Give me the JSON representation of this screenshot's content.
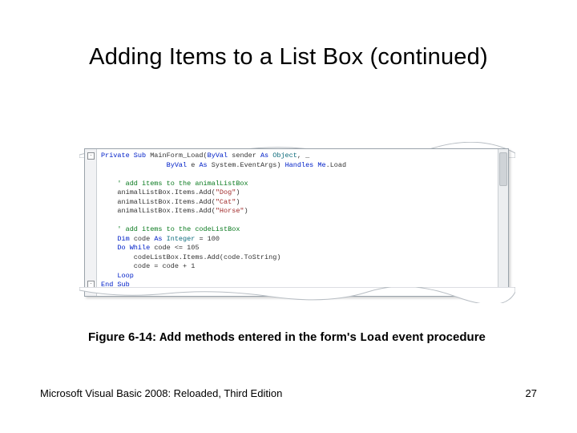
{
  "title": "Adding Items to a List Box (continued)",
  "code": {
    "l1a": "Private Sub",
    "l1b": " MainForm_Load(",
    "l1c": "ByVal",
    "l1d": " sender ",
    "l1e": "As",
    "l1f": " Object",
    "l1g": ", _",
    "l2a": "                ",
    "l2b": "ByVal",
    "l2c": " e ",
    "l2d": "As",
    "l2e": " System.EventArgs) ",
    "l2f": "Handles",
    "l2g": " ",
    "l2h": "Me",
    "l2i": ".Load",
    "blank1": "",
    "c1": "    ' add items to the animalListBox",
    "a1": "    animalListBox.Items.Add(",
    "a1s": "\"Dog\"",
    "a1e": ")",
    "a2": "    animalListBox.Items.Add(",
    "a2s": "\"Cat\"",
    "a2e": ")",
    "a3": "    animalListBox.Items.Add(",
    "a3s": "\"Horse\"",
    "a3e": ")",
    "blank2": "",
    "c2": "    ' add items to the codeListBox",
    "d1a": "    ",
    "d1b": "Dim",
    "d1c": " code ",
    "d1d": "As",
    "d1e": " Integer",
    "d1f": " = 100",
    "w1a": "    ",
    "w1b": "Do While",
    "w1c": " code <= 105",
    "b1": "        codeListBox.Items.Add(code.ToString)",
    "b2": "        code = code + 1",
    "lp": "    ",
    "lpk": "Loop",
    "es": "End Sub"
  },
  "caption": {
    "prefix": "Figure 6-14: ",
    "mono1": "Add",
    "mid": " methods entered in the form's ",
    "mono2": "Load",
    "suffix": " event procedure"
  },
  "footer": {
    "book": "Microsoft Visual Basic 2008: Reloaded, Third Edition",
    "page": "27"
  }
}
